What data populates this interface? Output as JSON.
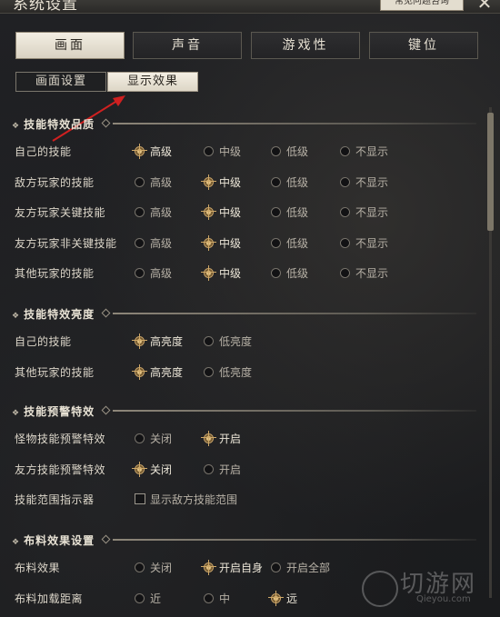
{
  "window": {
    "title": "系统设置",
    "top_hint": "常见问题咨询",
    "close_icon": "close-icon"
  },
  "main_tabs": [
    {
      "label": "画面",
      "active": true
    },
    {
      "label": "声音",
      "active": false
    },
    {
      "label": "游戏性",
      "active": false
    },
    {
      "label": "键位",
      "active": false
    }
  ],
  "sub_tabs": [
    {
      "label": "画面设置",
      "active": false
    },
    {
      "label": "显示效果",
      "active": true
    }
  ],
  "sections": [
    {
      "title": "技能特效品质",
      "rows": [
        {
          "label": "自己的技能",
          "options": [
            "高级",
            "中级",
            "低级",
            "不显示"
          ],
          "selected": 0
        },
        {
          "label": "敌方玩家的技能",
          "options": [
            "高级",
            "中级",
            "低级",
            "不显示"
          ],
          "selected": 1
        },
        {
          "label": "友方玩家关键技能",
          "options": [
            "高级",
            "中级",
            "低级",
            "不显示"
          ],
          "selected": 1
        },
        {
          "label": "友方玩家非关键技能",
          "options": [
            "高级",
            "中级",
            "低级",
            "不显示"
          ],
          "selected": 1
        },
        {
          "label": "其他玩家的技能",
          "options": [
            "高级",
            "中级",
            "低级",
            "不显示"
          ],
          "selected": 1
        }
      ]
    },
    {
      "title": "技能特效亮度",
      "rows": [
        {
          "label": "自己的技能",
          "options": [
            "高亮度",
            "低亮度"
          ],
          "selected": 0
        },
        {
          "label": "其他玩家的技能",
          "options": [
            "高亮度",
            "低亮度"
          ],
          "selected": 0
        }
      ]
    },
    {
      "title": "技能预警特效",
      "rows": [
        {
          "label": "怪物技能预警特效",
          "options": [
            "关闭",
            "开启"
          ],
          "selected": 1
        },
        {
          "label": "友方技能预警特效",
          "options": [
            "关闭",
            "开启"
          ],
          "selected": 0
        },
        {
          "label": "技能范围指示器",
          "checkbox": "显示敌方技能范围",
          "checked": false
        }
      ]
    },
    {
      "title": "布料效果设置",
      "rows": [
        {
          "label": "布料效果",
          "options": [
            "关闭",
            "开启自身",
            "开启全部"
          ],
          "selected": 1
        },
        {
          "label": "布料加载距离",
          "options": [
            "近",
            "中",
            "远"
          ],
          "selected": 2
        }
      ]
    }
  ],
  "watermark": {
    "text": "切游网",
    "url": "Qieyou.com"
  },
  "colors": {
    "accent": "#c9a46a",
    "arrow": "#d02020"
  }
}
